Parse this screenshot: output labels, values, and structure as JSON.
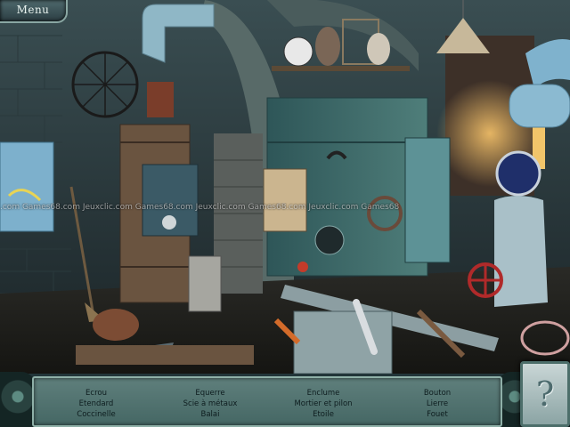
{
  "menu": {
    "label": "Menu"
  },
  "watermark": {
    "text": ".com  Games68.com  Jeuxclic.com  Games68.com  Jeuxclic.com  Games68.com  Jeuxclic.com  Games68"
  },
  "items": [
    {
      "id": "ecrou",
      "label": "Ecrou"
    },
    {
      "id": "etendard",
      "label": "Etendard"
    },
    {
      "id": "coccinelle",
      "label": "Coccinelle"
    },
    {
      "id": "equerre",
      "label": "Equerre"
    },
    {
      "id": "scie-a-metaux",
      "label": "Scie  à  métaux"
    },
    {
      "id": "balai",
      "label": "Balai"
    },
    {
      "id": "enclume",
      "label": "Enclume"
    },
    {
      "id": "mortier-et-pilon",
      "label": "Mortier et pilon"
    },
    {
      "id": "etoile",
      "label": "Etoile"
    },
    {
      "id": "bouton",
      "label": "Bouton"
    },
    {
      "id": "lierre",
      "label": "Lierre"
    },
    {
      "id": "fouet",
      "label": "Fouet"
    }
  ],
  "hint": {
    "icon": "question-mark-icon",
    "symbol": "?"
  },
  "colors": {
    "hud_panel": "#5f7f7c",
    "hud_border": "#8fb0a8",
    "scene_dark": "#1b2a2e"
  }
}
